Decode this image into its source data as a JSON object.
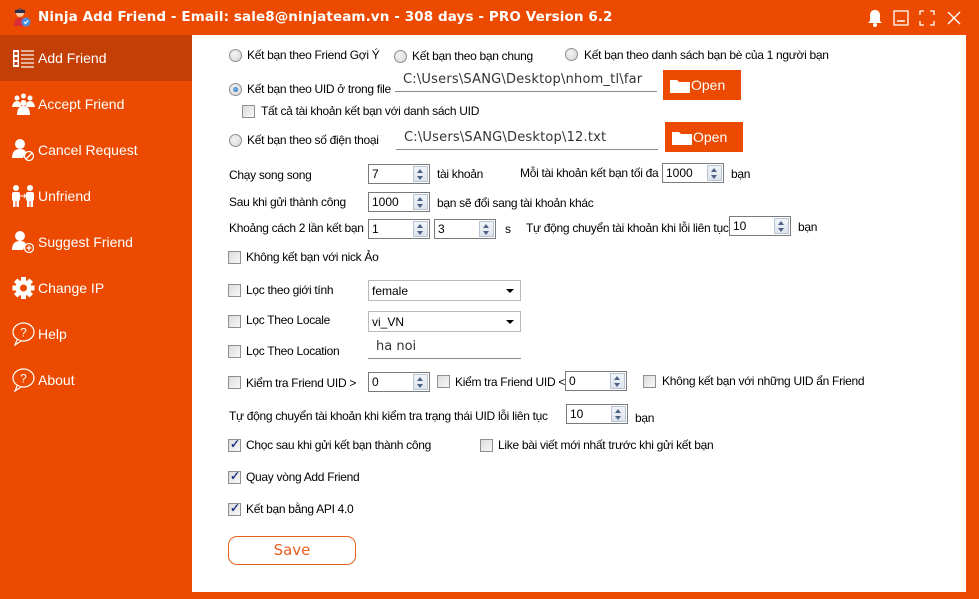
{
  "window": {
    "title": "Ninja Add Friend - Email: sale8@ninjateam.vn - 308 days - PRO Version 6.2",
    "controls": [
      "bell-icon",
      "minimize-icon",
      "maximize-icon",
      "close-icon"
    ]
  },
  "sidebar": {
    "items": [
      {
        "label": "Add Friend",
        "icon": "list-icon",
        "active": true
      },
      {
        "label": "Accept Friend",
        "icon": "users-group-icon",
        "active": false
      },
      {
        "label": "Cancel Request",
        "icon": "user-block-icon",
        "active": false
      },
      {
        "label": "Unfriend",
        "icon": "unfriend-icon",
        "active": false
      },
      {
        "label": "Suggest Friend",
        "icon": "user-add-icon",
        "active": false
      },
      {
        "label": "Change IP",
        "icon": "gear-icon",
        "active": false
      },
      {
        "label": "Help",
        "icon": "help-bubble-icon",
        "active": false
      },
      {
        "label": "About",
        "icon": "help-bubble-icon",
        "active": false
      }
    ]
  },
  "form": {
    "mode_options": [
      {
        "label": "Kết bạn theo Friend Gợi Ý",
        "selected": false
      },
      {
        "label": "Kết bạn theo bạn chung",
        "selected": false
      },
      {
        "label": "Kết bạn theo danh sách bạn bè của 1 người bạn",
        "selected": false
      },
      {
        "label": "Kết bạn theo UID ở trong file",
        "selected": true
      },
      {
        "label": "Kết bạn theo số điện thoại",
        "selected": false
      }
    ],
    "uid_file_path": "C:\\Users\\SANG\\Desktop\\nhom_tl\\far",
    "phone_file_path": "C:\\Users\\SANG\\Desktop\\12.txt",
    "open_label": "Open",
    "all_accounts_uid": {
      "label": "Tất cả tài khoản kết bạn với danh sách UID",
      "checked": false
    },
    "parallel": {
      "label": "Chạy song song",
      "value": "7",
      "unit": "tài khoản"
    },
    "max_per_account": {
      "label": "Mỗi tài khoản kết bạn tối đa",
      "value": "1000",
      "unit": "bạn"
    },
    "after_success": {
      "label": "Sau khi gửi thành công",
      "value": "1000",
      "unit": "bạn sẽ đổi sang tài khoản khác"
    },
    "interval": {
      "label": "Khoảng cách 2 lần kết bạn",
      "min": "1",
      "max": "3",
      "unit": "s"
    },
    "auto_switch_error": {
      "label": "Tự động chuyển tài khoản khi lỗi liên tục",
      "value": "10",
      "unit": "bạn"
    },
    "no_fake_nick": {
      "label": "Không kết bạn với nick Ảo",
      "checked": false
    },
    "filter_gender": {
      "label": "Lọc theo giới tính",
      "checked": false,
      "value": "female"
    },
    "filter_locale": {
      "label": "Lọc Theo Locale",
      "checked": false,
      "value": "vi_VN"
    },
    "filter_location": {
      "label": "Lọc Theo Location",
      "checked": false,
      "value": "ha noi"
    },
    "uid_gt": {
      "label": "Kiểm tra Friend UID >",
      "checked": false,
      "value": "0"
    },
    "uid_lt": {
      "label": "Kiểm tra Friend UID <",
      "checked": false,
      "value": "0"
    },
    "hidden_uid": {
      "label": "Không kết bạn với những UID ẩn Friend",
      "checked": false
    },
    "auto_switch_uid": {
      "label": "Tự động chuyển tài khoản khi kiểm tra trạng thái UID lỗi liên tục",
      "value": "10",
      "unit": "bạn"
    },
    "poke_after": {
      "label": "Chọc sau khi gửi kết bạn thành công",
      "checked": true
    },
    "like_post": {
      "label": "Like bài viết mới nhất trước khi gửi kết bạn",
      "checked": false
    },
    "loop_add": {
      "label": "Quay vòng Add Friend",
      "checked": true
    },
    "api4": {
      "label": "Kết bạn bằng API 4.0",
      "checked": true
    },
    "save_label": "Save"
  },
  "colors": {
    "brand": "#eb4a00",
    "brand_dark": "#c43f05"
  }
}
